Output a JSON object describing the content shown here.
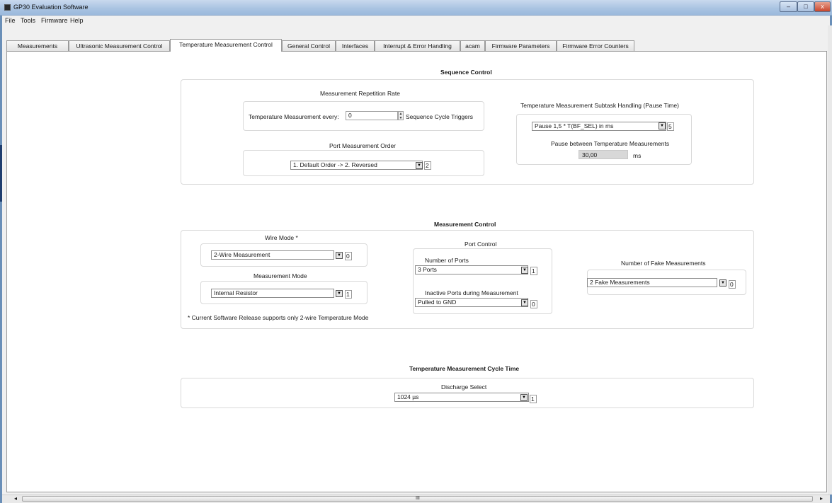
{
  "window": {
    "title": "GP30 Evaluation Software"
  },
  "menu": [
    "File",
    "Tools",
    "Firmware",
    "Help"
  ],
  "tabs": [
    {
      "label": "Measurements"
    },
    {
      "label": "Ultrasonic Measurement Control"
    },
    {
      "label": "Temperature Measurement Control"
    },
    {
      "label": "General Control"
    },
    {
      "label": "Interfaces"
    },
    {
      "label": "Interrupt & Error Handling"
    },
    {
      "label": "acam"
    },
    {
      "label": "Firmware Parameters"
    },
    {
      "label": "Firmware Error Counters"
    }
  ],
  "active_tab": "Temperature Measurement Control",
  "sequence_control": {
    "title": "Sequence Control",
    "repetition": {
      "title": "Measurement Repetition Rate",
      "prefix": "Temperature Measurement every:",
      "value": "0",
      "suffix": "Sequence Cycle Triggers"
    },
    "port_order": {
      "title": "Port Measurement Order",
      "selected": "1. Default Order -> 2. Reversed",
      "index": "2"
    },
    "subtask": {
      "title": "Temperature Measurement Subtask Handling (Pause Time)",
      "selected": "Pause 1,5 * T(BF_SEL) in ms",
      "index": "5",
      "pause_label": "Pause between Temperature Measurements",
      "pause_value": "30,00",
      "pause_unit": "ms"
    }
  },
  "measurement_control": {
    "title": "Measurement Control",
    "wire_mode": {
      "title": "Wire Mode *",
      "selected": "2-Wire Measurement",
      "index": "0"
    },
    "measurement_mode": {
      "title": "Measurement Mode",
      "selected": "Internal Resistor",
      "index": "1"
    },
    "footnote": "* Current Software Release supports only 2-wire Temperature Mode",
    "port_control": {
      "title": "Port Control",
      "ports_label": "Number of Ports",
      "ports_selected": "3 Ports",
      "ports_index": "1",
      "inactive_label": "Inactive Ports during Measurement",
      "inactive_selected": "Pulled to GND",
      "inactive_index": "0"
    },
    "fake": {
      "title": "Number of Fake Measurements",
      "selected": "2 Fake Measurements",
      "index": "0"
    }
  },
  "cycle_time": {
    "title": "Temperature Measurement Cycle Time",
    "discharge_label": "Discharge Select",
    "selected": "1024 µs",
    "index": "1"
  },
  "scrollbar": {
    "grip": "III"
  },
  "icons": {
    "dropdown": "▼",
    "spin_up": "▲",
    "spin_down": "▼",
    "minimize": "–",
    "maximize": "□",
    "close": "x",
    "scroll_left": "◂",
    "scroll_right": "▸"
  }
}
